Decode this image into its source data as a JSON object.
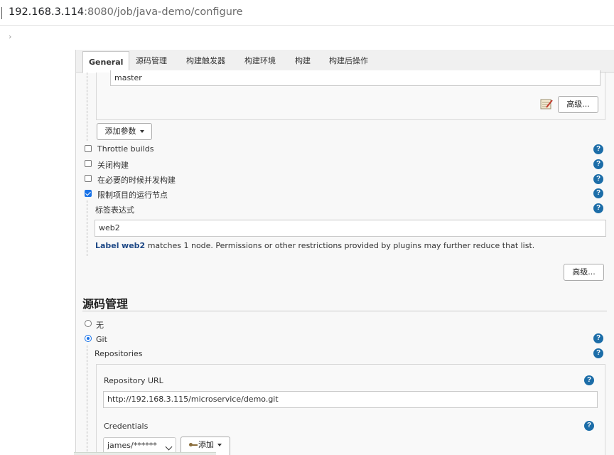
{
  "browser": {
    "url_host": "192.168.3.114",
    "url_rest": ":8080/job/java-demo/configure"
  },
  "tabs": [
    "General",
    "源码管理",
    "构建触发器",
    "构建环境",
    "构建",
    "构建后操作"
  ],
  "parameter": {
    "default_value": "master",
    "advanced_label": "高级...",
    "add_parameter_label": "添加参数"
  },
  "options": [
    {
      "label": "Throttle builds",
      "checked": false
    },
    {
      "label": "关闭构建",
      "checked": false
    },
    {
      "label": "在必要的时候并发构建",
      "checked": false
    },
    {
      "label": "限制项目的运行节点",
      "checked": true
    }
  ],
  "label_expression": {
    "label": "标签表达式",
    "value": "web2",
    "info_link_prefix": "Label",
    "info_link_name": "web2",
    "info_rest": " matches 1 node. Permissions or other restrictions provided by plugins may further reduce that list."
  },
  "general_advanced_label": "高级...",
  "scm": {
    "title": "源码管理",
    "none_label": "无",
    "git_label": "Git",
    "selected": "Git",
    "repositories_label": "Repositories",
    "repo_url_label": "Repository URL",
    "repo_url_value": "http://192.168.3.115/microservice/demo.git",
    "credentials_label": "Credentials",
    "credentials_value": "james/******",
    "add_label": "添加"
  },
  "help_glyph": "?",
  "colors": {
    "help_blue": "#1c6da8",
    "link": "#204a87",
    "checkbox_blue": "#1a73e8"
  }
}
